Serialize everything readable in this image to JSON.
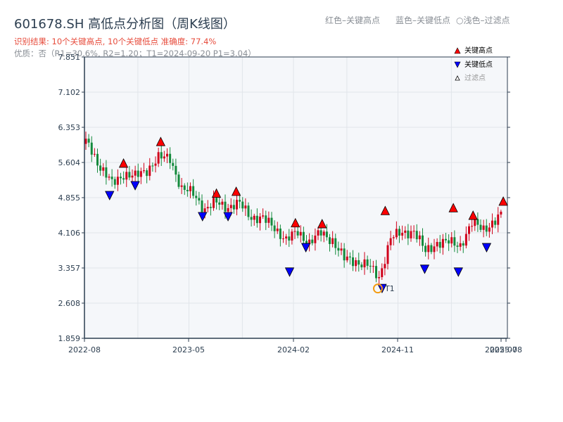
{
  "header": {
    "title": "601678.SH 高低点分析图（周K线图）",
    "result": "识别结果: 10个关键高点, 10个关键低点   准确度: 77.4%",
    "quality": "优质：否（R1=30.6%, R2=1.20；T1=2024-09-20 P1=3.04）",
    "hint_red": "红色–关键高点",
    "hint_blue": "蓝色–关键低点",
    "hint_light": "○浅色–过滤点"
  },
  "colors": {
    "up": "#d0021b",
    "down": "#138a3c",
    "high_marker": "#ff0000",
    "low_marker": "#0000ff",
    "t1": "#f39c12",
    "plot_bg": "#f5f7fa",
    "axis": "#2c3e50"
  },
  "chart_data": {
    "type": "candlestick",
    "title": "601678.SH 高低点分析图（周K线图）",
    "ylim": [
      1.859,
      7.851
    ],
    "y_ticks": [
      "7.851",
      "7.102",
      "6.353",
      "5.604",
      "4.855",
      "4.106",
      "3.357",
      "2.608",
      "1.859"
    ],
    "x_ticks": [
      "2022-08",
      "2023-05",
      "2024-02",
      "2024-11",
      "2025-07",
      "2025-08"
    ],
    "grid": true,
    "legend": {
      "placement": "top-right",
      "entries": [
        "关键高点",
        "关键低点",
        "过滤点"
      ]
    },
    "monthly_close": {
      "start": "2022-08",
      "values": [
        5.99,
        5.5,
        5.15,
        5.36,
        5.3,
        5.45,
        5.7,
        5.7,
        5.03,
        4.95,
        4.6,
        4.75,
        4.66,
        4.72,
        4.45,
        4.4,
        4.22,
        3.95,
        4.12,
        3.9,
        4.1,
        3.95,
        3.55,
        3.5,
        3.42,
        3.15,
        4.0,
        4.1,
        4.15,
        3.7,
        3.9,
        3.9,
        3.85,
        4.3,
        4.2,
        4.35,
        4.6
      ]
    },
    "key_highs": [
      {
        "date": "2022-11-12",
        "price": 5.47
      },
      {
        "date": "2023-02-18",
        "price": 5.93
      },
      {
        "date": "2023-07-12",
        "price": 4.83
      },
      {
        "date": "2023-09-03",
        "price": 4.87
      },
      {
        "date": "2024-02-06",
        "price": 4.2
      },
      {
        "date": "2024-04-15",
        "price": 4.18
      },
      {
        "date": "2024-09-28",
        "price": 4.46
      },
      {
        "date": "2025-03-24",
        "price": 4.52
      },
      {
        "date": "2025-05-15",
        "price": 4.36
      },
      {
        "date": "2025-08-03",
        "price": 4.66
      }
    ],
    "key_lows": [
      {
        "date": "2022-10-06",
        "price": 5.02
      },
      {
        "date": "2022-12-12",
        "price": 5.23
      },
      {
        "date": "2023-06-06",
        "price": 4.57
      },
      {
        "date": "2023-08-12",
        "price": 4.57
      },
      {
        "date": "2024-01-21",
        "price": 3.39
      },
      {
        "date": "2024-03-03",
        "price": 3.91
      },
      {
        "date": "2024-09-20",
        "price": 3.04
      },
      {
        "date": "2025-01-10",
        "price": 3.45
      },
      {
        "date": "2025-04-07",
        "price": 3.39
      },
      {
        "date": "2025-06-20",
        "price": 3.91
      }
    ],
    "t1": {
      "label": "T1",
      "date": "2024-09-20",
      "price": 3.04
    }
  }
}
